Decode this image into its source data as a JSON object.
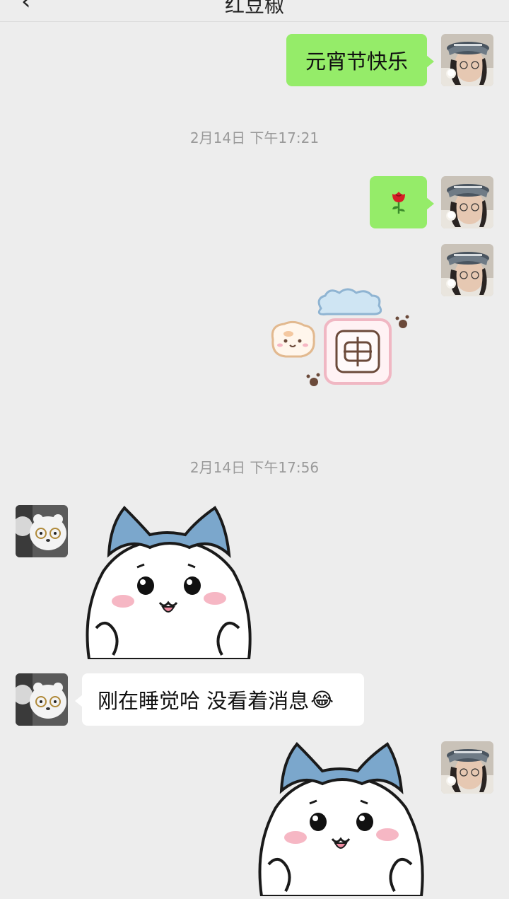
{
  "header": {
    "back_glyph": "‹",
    "title": "红豆椒"
  },
  "messages": [
    {
      "type": "text",
      "side": "right",
      "text": "元宵节快乐"
    },
    {
      "type": "timestamp",
      "text": "2月14日 下午17:21"
    },
    {
      "type": "emoji",
      "side": "right",
      "icon": "rose-emoji-icon",
      "glyph": "🌹"
    },
    {
      "type": "sticker",
      "side": "right",
      "icon": "clouds-and-rice-character-sticker"
    },
    {
      "type": "timestamp",
      "text": "2月14日 下午17:56"
    },
    {
      "type": "sticker",
      "side": "left",
      "icon": "hachiware-cat-sticker"
    },
    {
      "type": "text",
      "side": "left",
      "text": "刚在睡觉哈 没看着消息",
      "emoji": "😂"
    },
    {
      "type": "sticker",
      "side": "right",
      "icon": "hachiware-cat-sticker"
    }
  ],
  "colors": {
    "background": "#ededed",
    "sent_bubble": "#95ec69",
    "received_bubble": "#ffffff",
    "timestamp_text": "#9a9a9a",
    "cat_ear_blue": "#7ba7cc",
    "blush_pink": "#f6b7c4"
  }
}
